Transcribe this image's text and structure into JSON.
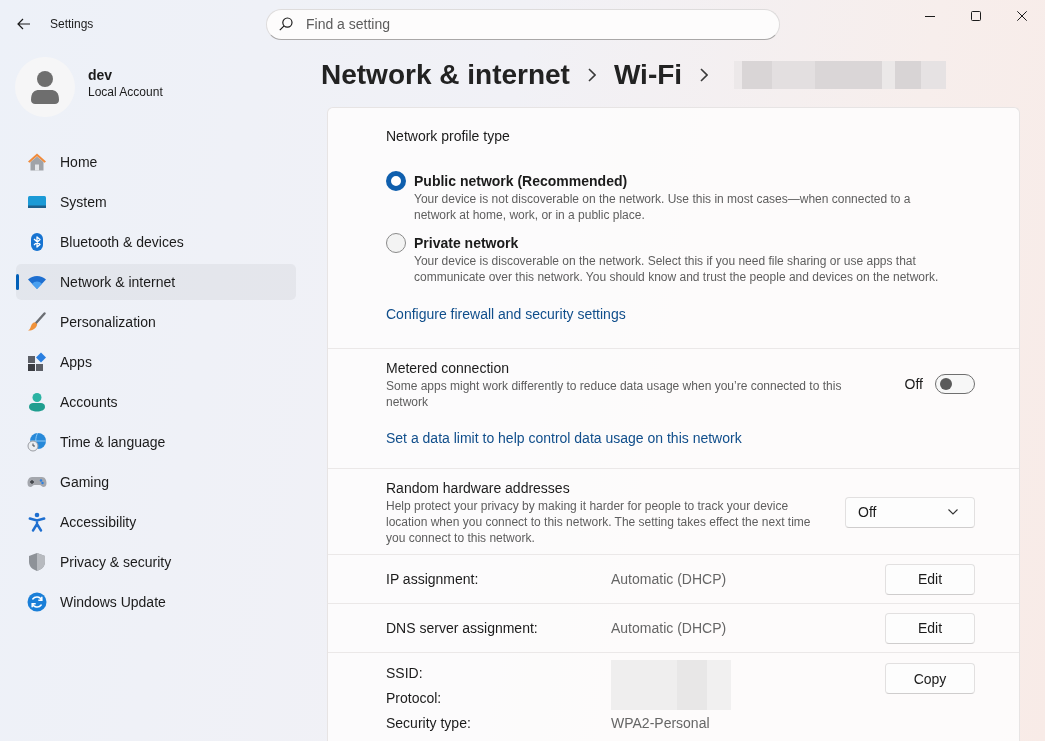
{
  "window": {
    "title": "Settings"
  },
  "search": {
    "placeholder": "Find a setting"
  },
  "account": {
    "name": "dev",
    "type": "Local Account"
  },
  "nav": [
    {
      "label": "Home",
      "selected": false
    },
    {
      "label": "System",
      "selected": false
    },
    {
      "label": "Bluetooth & devices",
      "selected": false
    },
    {
      "label": "Network & internet",
      "selected": true
    },
    {
      "label": "Personalization",
      "selected": false
    },
    {
      "label": "Apps",
      "selected": false
    },
    {
      "label": "Accounts",
      "selected": false
    },
    {
      "label": "Time & language",
      "selected": false
    },
    {
      "label": "Gaming",
      "selected": false
    },
    {
      "label": "Accessibility",
      "selected": false
    },
    {
      "label": "Privacy & security",
      "selected": false
    },
    {
      "label": "Windows Update",
      "selected": false
    }
  ],
  "breadcrumb": [
    {
      "label": "Network & internet",
      "redacted": false
    },
    {
      "label": "Wi-Fi",
      "redacted": false
    },
    {
      "redacted": true
    }
  ],
  "network_profile": {
    "title": "Network profile type",
    "options": [
      {
        "label": "Public network (Recommended)",
        "description": "Your device is not discoverable on the network. Use this in most cases—when connected to a network at home, work, or in a public place.",
        "selected": true
      },
      {
        "label": "Private network",
        "description": "Your device is discoverable on the network. Select this if you need file sharing or use apps that communicate over this network. You should know and trust the people and devices on the network.",
        "selected": false
      }
    ],
    "link": "Configure firewall and security settings"
  },
  "metered_connection": {
    "title": "Metered connection",
    "description": "Some apps might work differently to reduce data usage when you’re connected to this network",
    "toggle": {
      "on": false,
      "label": "Off"
    },
    "link": "Set a data limit to help control data usage on this network"
  },
  "random_hardware_addresses": {
    "title": "Random hardware addresses",
    "description": "Help protect your privacy by making it harder for people to track your device location when you connect to this network. The setting takes effect the next time you connect to this network.",
    "dropdown": {
      "value": "Off"
    }
  },
  "assignments": [
    {
      "label": "IP assignment:",
      "value": "Automatic (DHCP)",
      "button": "Edit"
    },
    {
      "label": "DNS server assignment:",
      "value": "Automatic (DHCP)",
      "button": "Edit"
    }
  ],
  "network_details": {
    "rows": [
      {
        "label": "SSID:",
        "redacted": true
      },
      {
        "label": "Protocol:",
        "redacted": true
      },
      {
        "label": "Security type:",
        "value": "WPA2-Personal",
        "redacted": false
      }
    ],
    "button": "Copy"
  }
}
